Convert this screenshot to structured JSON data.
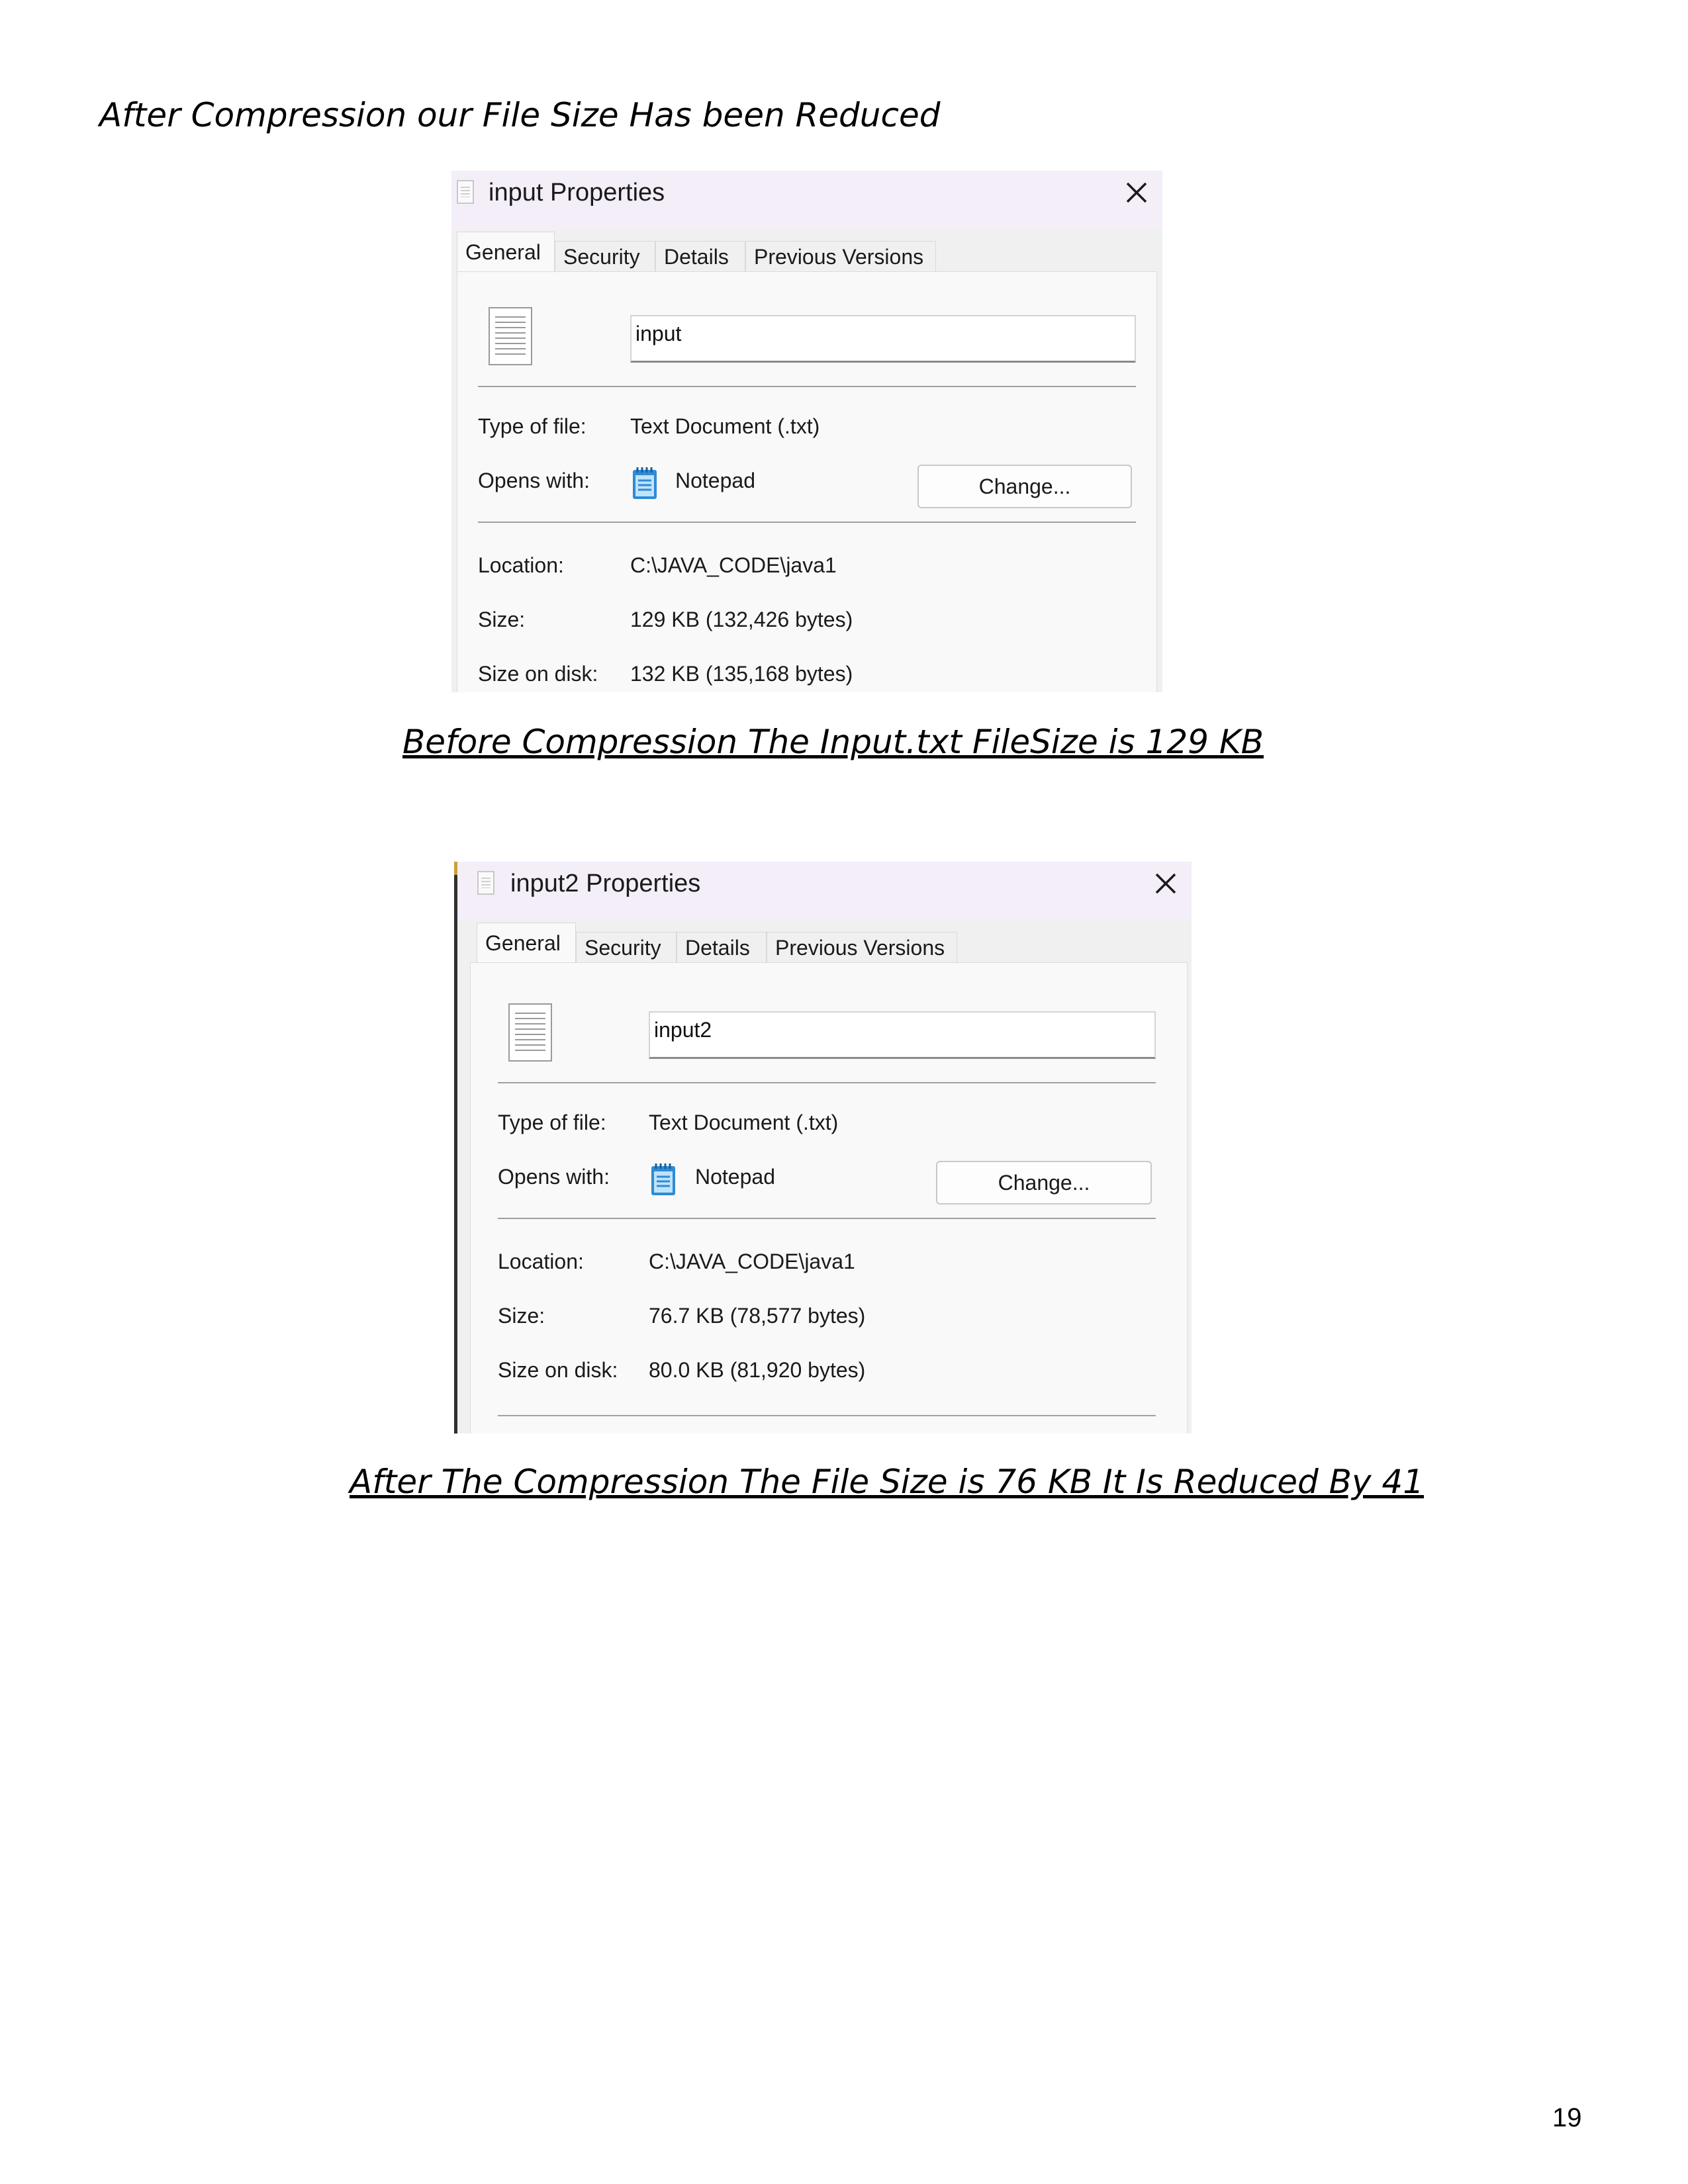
{
  "heading": "After Compression our File Size Has been Reduced",
  "dialogs": [
    {
      "title": "input Properties",
      "tabs": [
        "General",
        "Security",
        "Details",
        "Previous Versions"
      ],
      "file_name": "input",
      "type_label": "Type of file:",
      "type_value": "Text Document (.txt)",
      "opens_label": "Opens with:",
      "opens_value": "Notepad",
      "change_label": "Change...",
      "location_label": "Location:",
      "location_value": "C:\\JAVA_CODE\\java1",
      "size_label": "Size:",
      "size_value": "129 KB (132,426 bytes)",
      "disk_label": "Size on disk:",
      "disk_value": "132 KB (135,168 bytes)"
    },
    {
      "title": "input2 Properties",
      "tabs": [
        "General",
        "Security",
        "Details",
        "Previous Versions"
      ],
      "file_name": "input2",
      "type_label": "Type of file:",
      "type_value": "Text Document (.txt)",
      "opens_label": "Opens with:",
      "opens_value": "Notepad",
      "change_label": "Change...",
      "location_label": "Location:",
      "location_value": "C:\\JAVA_CODE\\java1",
      "size_label": "Size:",
      "size_value": "76.7 KB (78,577 bytes)",
      "disk_label": "Size on disk:",
      "disk_value": "80.0 KB (81,920 bytes)"
    }
  ],
  "caption_before": "Before Compression The Input.txt FileSize is 129 KB",
  "caption_after": "After The Compression The File Size is 76 KB  It Is Reduced By 41",
  "page_number": "19",
  "colors": {
    "titlebar": "#f3eef8",
    "dialog_bg": "#f0f0f0",
    "panel_bg": "#f9f9f9",
    "notepad_blue": "#2e8bd6"
  },
  "icons": [
    "document-icon",
    "close-icon",
    "file-icon",
    "notepad-icon"
  ]
}
